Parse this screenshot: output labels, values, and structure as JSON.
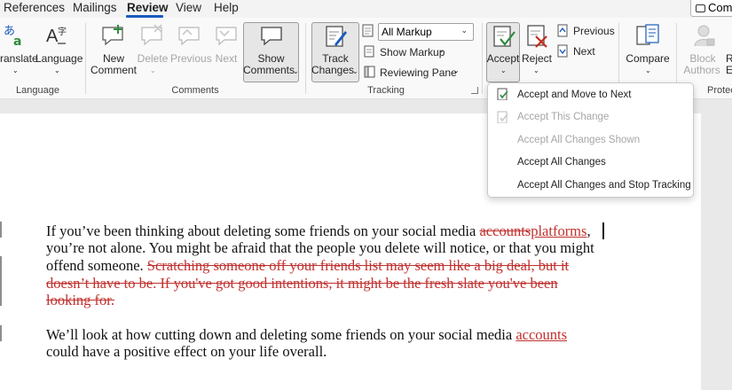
{
  "menubar": {
    "items": [
      "References",
      "Mailings",
      "Review",
      "View",
      "Help"
    ],
    "active": "Review",
    "comments_button": "Comm"
  },
  "ribbon": {
    "language_group": {
      "translate": "ranslate",
      "language": "Language",
      "label": "Language"
    },
    "comments_group": {
      "new_comment": [
        "New",
        "Comment"
      ],
      "delete": "Delete",
      "previous": "Previous",
      "next": "Next",
      "show_comments": [
        "Show",
        "Comments"
      ],
      "label": "Comments"
    },
    "tracking_group": {
      "track_changes": [
        "Track",
        "Changes"
      ],
      "markup_select": "All Markup",
      "show_markup": "Show Markup",
      "reviewing_pane": "Reviewing Pane",
      "label": "Tracking"
    },
    "changes_group": {
      "accept": "Accept",
      "reject": "Reject",
      "previous": "Previous",
      "next": "Next"
    },
    "compare_group": {
      "compare": "Compare"
    },
    "protect_group": {
      "block_authors": [
        "Block",
        "Authors"
      ],
      "r_label": "R",
      "e_label": "E",
      "label": "Protect"
    }
  },
  "accept_menu": {
    "items": [
      {
        "label": "Accept and Move to Next",
        "enabled": true
      },
      {
        "label": "Accept This Change",
        "enabled": false
      },
      {
        "label": "Accept All Changes Shown",
        "enabled": false
      },
      {
        "label": "Accept All Changes",
        "enabled": true
      },
      {
        "label": "Accept All Changes and Stop Tracking",
        "enabled": true
      }
    ]
  },
  "document": {
    "para1": {
      "line1_text": "If you’ve been thinking about deleting some friends on your social media ",
      "line1_deleted": "accounts",
      "line1_inserted": "platforms",
      "line1_tail": ",",
      "line2": "you’re not alone. You might be afraid that the people you delete will notice, or that you might",
      "line3_text": "offend someone. ",
      "line3_deleted": "Scratching someone off your friends list may seem like a big deal, but it",
      "line4_deleted": "doesn’t have to be. If you've got good intentions, it might be the fresh slate you've been",
      "line5_deleted": "looking for. "
    },
    "para2": {
      "line1_text": "We’ll look at how cutting down and deleting some friends on your social media ",
      "line1_inserted": "accounts",
      "line2": "could have a positive effect on your life overall."
    }
  },
  "colors": {
    "revision": "#c0302e",
    "accent": "#185abd",
    "icon_green": "#2e8b3d",
    "icon_red": "#c42b1c"
  }
}
